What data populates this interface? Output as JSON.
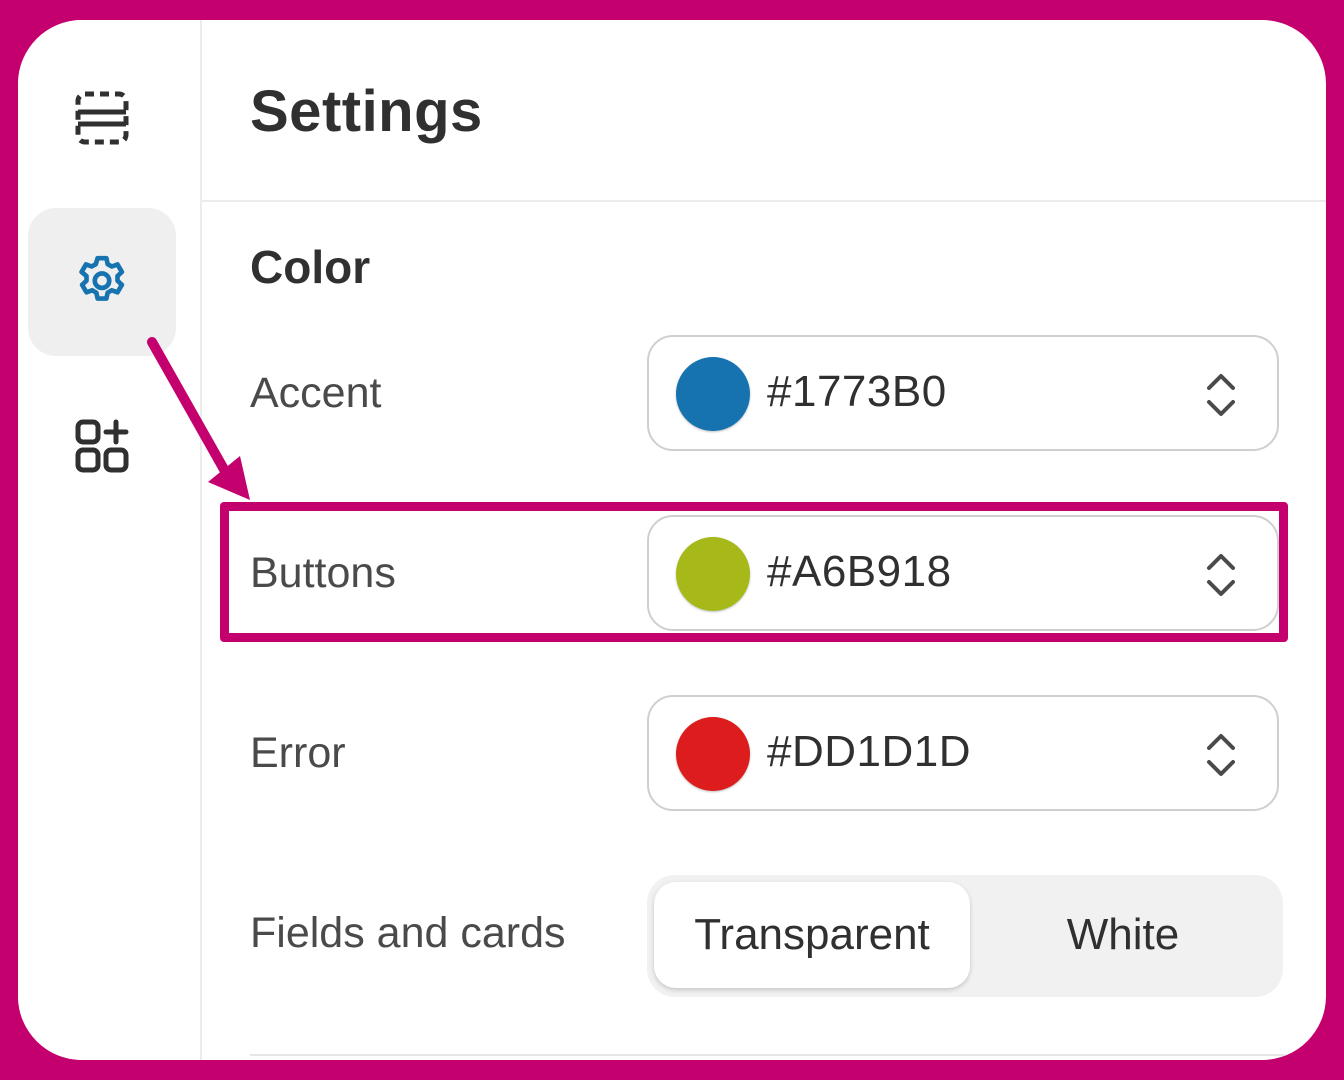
{
  "header": {
    "title": "Settings"
  },
  "rail": {
    "items": [
      {
        "icon": "layout-dashed-icon",
        "active": false
      },
      {
        "icon": "gear-icon",
        "active": true
      },
      {
        "icon": "add-apps-icon",
        "active": false
      }
    ]
  },
  "section": {
    "title": "Color",
    "colors": [
      {
        "label": "Accent",
        "value": "#1773B0",
        "swatch": "#1773B0"
      },
      {
        "label": "Buttons",
        "value": "#A6B918",
        "swatch": "#A6B918"
      },
      {
        "label": "Error",
        "value": "#DD1D1D",
        "swatch": "#DD1D1D"
      }
    ],
    "fields_and_cards": {
      "label": "Fields and cards",
      "options": [
        "Transparent",
        "White"
      ],
      "selected": "Transparent"
    }
  },
  "annotation": {
    "highlight_color": "#C4006F"
  }
}
